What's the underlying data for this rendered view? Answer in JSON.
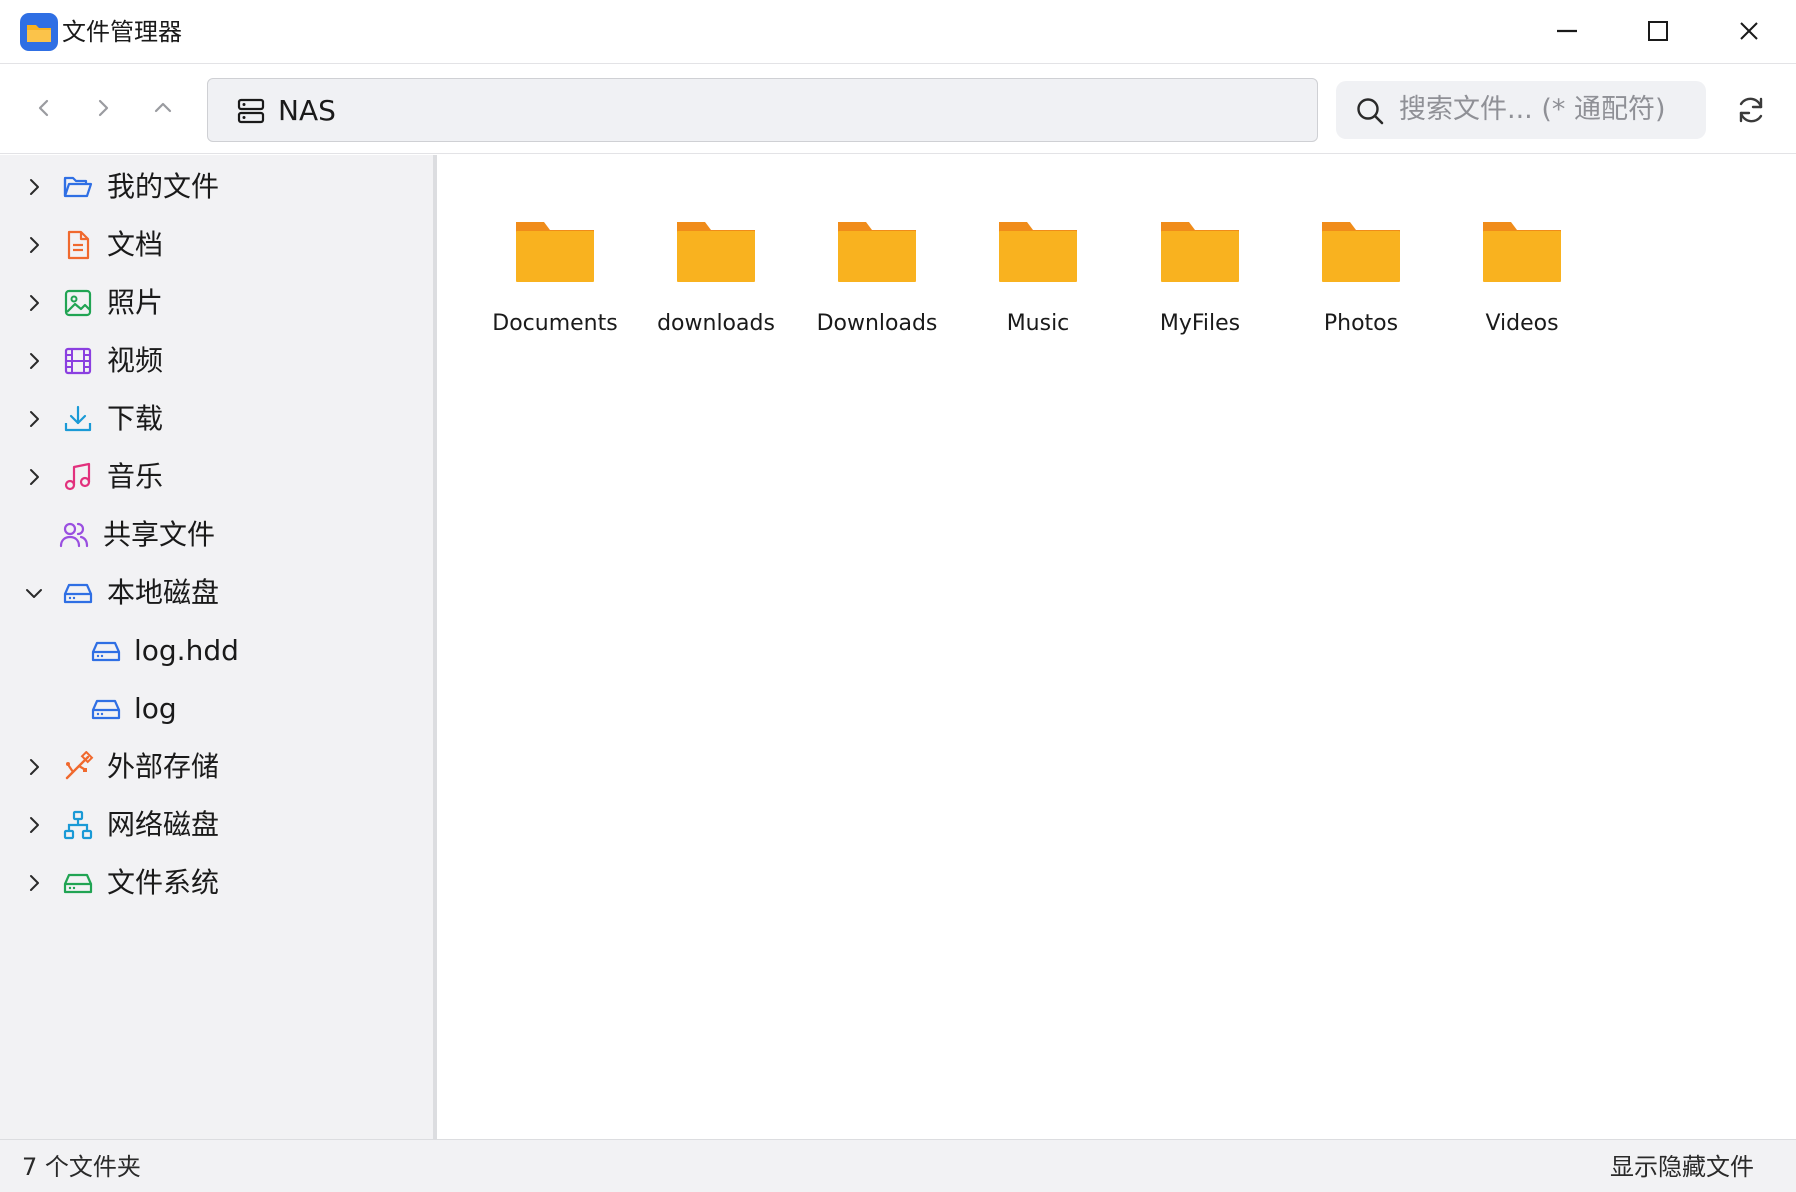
{
  "window": {
    "title": "文件管理器",
    "icon": "folder-app-icon"
  },
  "toolbar": {
    "address": "NAS",
    "address_icon": "server-icon",
    "search_placeholder": "搜索文件... (* 通配符)"
  },
  "sidebar": {
    "items": [
      {
        "label": "我的文件",
        "icon": "folder-open-icon",
        "color": "#2f6fe4",
        "expandable": true
      },
      {
        "label": "文档",
        "icon": "document-icon",
        "color": "#f0692e",
        "expandable": true
      },
      {
        "label": "照片",
        "icon": "image-icon",
        "color": "#21a453",
        "expandable": true
      },
      {
        "label": "视频",
        "icon": "film-icon",
        "color": "#8b3fe0",
        "expandable": true
      },
      {
        "label": "下载",
        "icon": "download-icon",
        "color": "#1a9ad6",
        "expandable": true
      },
      {
        "label": "音乐",
        "icon": "music-icon",
        "color": "#e2317d",
        "expandable": true
      },
      {
        "label": "共享文件",
        "icon": "users-icon",
        "color": "#9a4fe0",
        "expandable": false
      },
      {
        "label": "本地磁盘",
        "icon": "hard-drive-icon",
        "color": "#2f6fe4",
        "expandable": true,
        "expanded": true
      },
      {
        "label": "log.hdd",
        "icon": "hard-drive-icon",
        "color": "#2f6fe4",
        "expandable": false
      },
      {
        "label": "log",
        "icon": "hard-drive-icon",
        "color": "#2f6fe4",
        "expandable": false
      },
      {
        "label": "外部存储",
        "icon": "usb-icon",
        "color": "#f0692e",
        "expandable": true
      },
      {
        "label": "网络磁盘",
        "icon": "network-icon",
        "color": "#1a9ad6",
        "expandable": true
      },
      {
        "label": "文件系统",
        "icon": "hard-drive-icon",
        "color": "#21a453",
        "expandable": true
      }
    ]
  },
  "main": {
    "folders": [
      {
        "name": "Documents"
      },
      {
        "name": "downloads"
      },
      {
        "name": "Downloads"
      },
      {
        "name": "Music"
      },
      {
        "name": "MyFiles"
      },
      {
        "name": "Photos"
      },
      {
        "name": "Videos"
      }
    ],
    "folder_color": "#f9b21f",
    "folder_tab_color": "#f08c1a"
  },
  "status": {
    "count": "7 个文件夹",
    "show_hidden": "显示隐藏文件"
  }
}
